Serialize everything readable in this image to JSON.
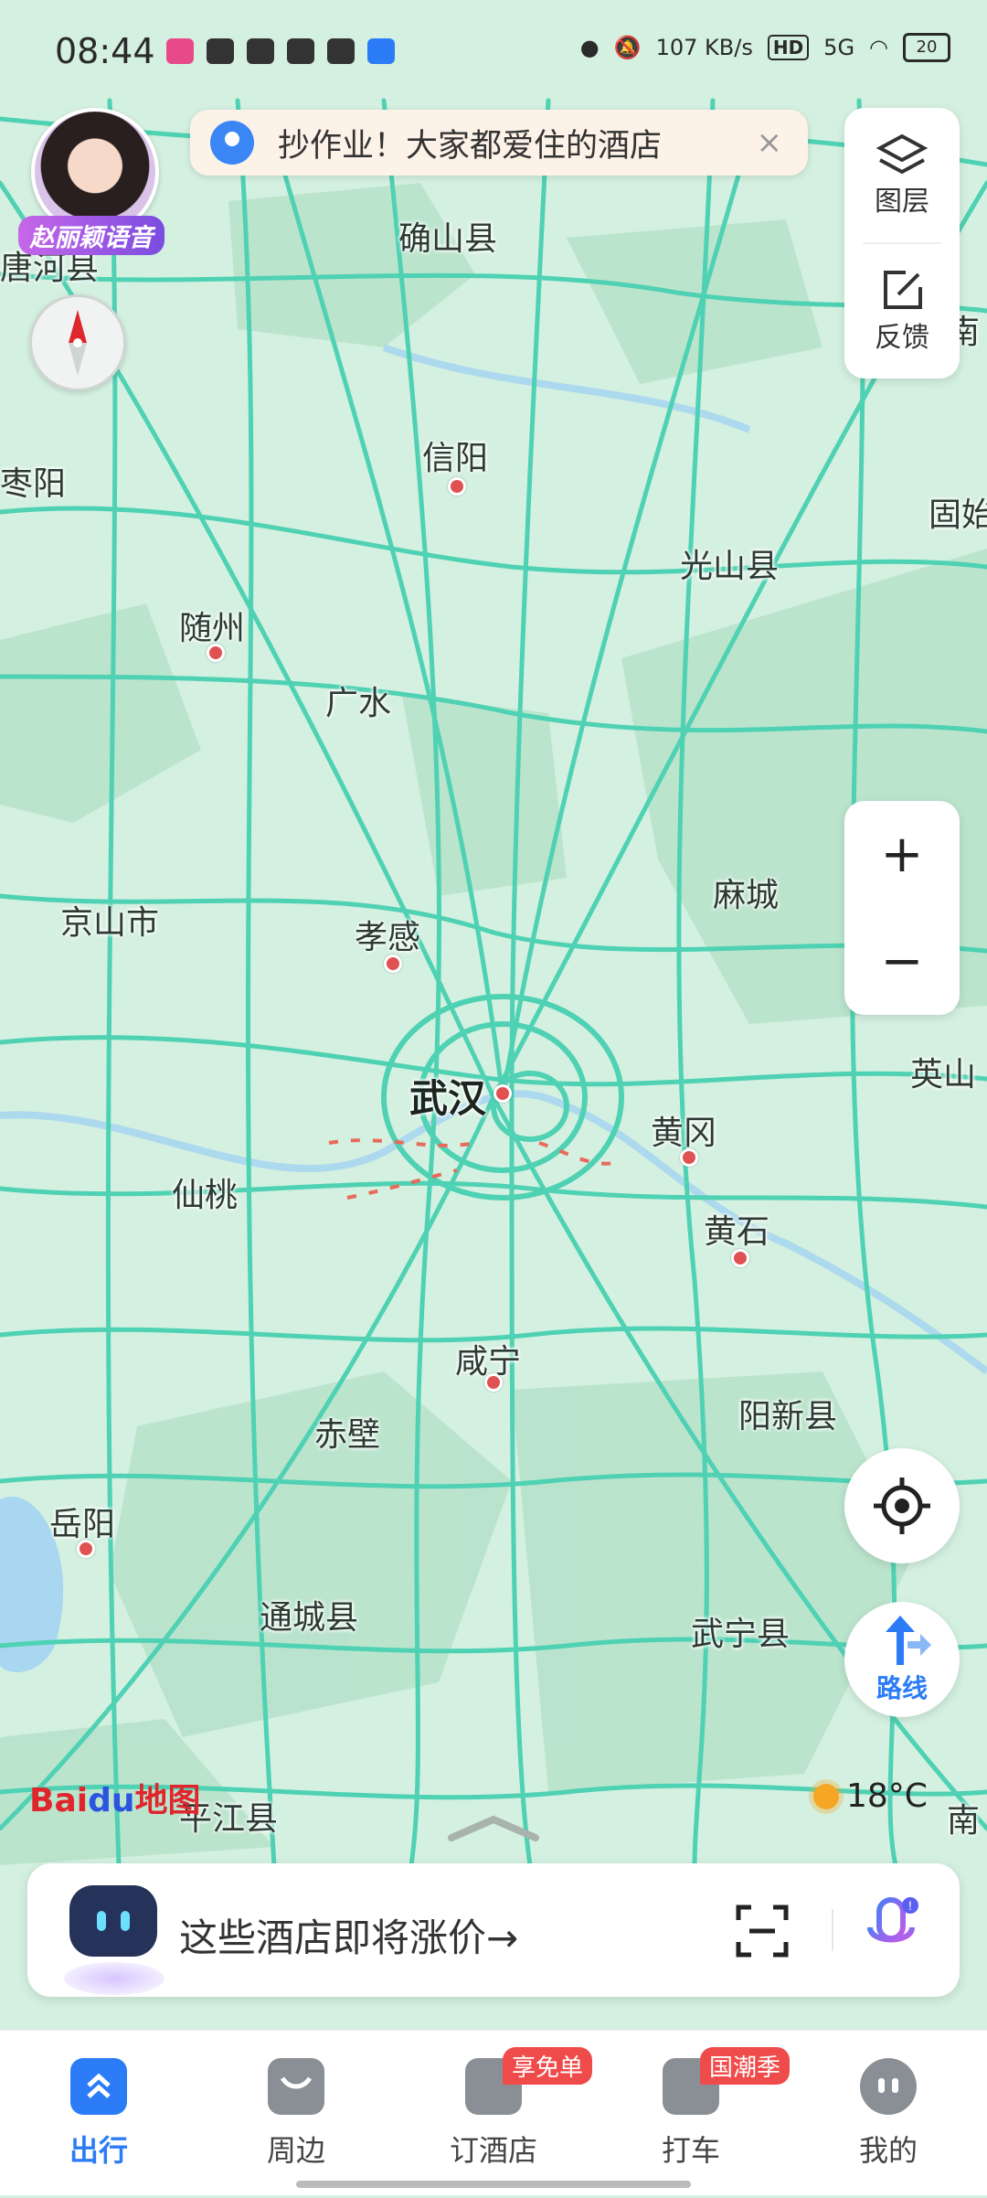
{
  "status_bar": {
    "time": "08:44",
    "net_speed": "107 KB/s",
    "hd": "HD",
    "signal": "5G",
    "battery": "20"
  },
  "voice_pack": {
    "label": "赵丽颖语音"
  },
  "banner": {
    "text": "抄作业！大家都爱住的酒店",
    "close": "×"
  },
  "right_panel": {
    "layers_label": "图层",
    "feedback_label": "反馈",
    "zoom_in": "+",
    "zoom_out": "−",
    "route_label": "路线"
  },
  "map_labels": [
    {
      "name": "确山县"
    },
    {
      "name": "唐河县"
    },
    {
      "name": "枣阳"
    },
    {
      "name": "信阳"
    },
    {
      "name": "固始"
    },
    {
      "name": "光山县"
    },
    {
      "name": "随州"
    },
    {
      "name": "广水"
    },
    {
      "name": "麻城"
    },
    {
      "name": "京山市"
    },
    {
      "name": "孝感"
    },
    {
      "name": "武汉"
    },
    {
      "name": "英山"
    },
    {
      "name": "黄冈"
    },
    {
      "name": "仙桃"
    },
    {
      "name": "黄石"
    },
    {
      "name": "咸宁"
    },
    {
      "name": "阳新县"
    },
    {
      "name": "赤壁"
    },
    {
      "name": "岳阳"
    },
    {
      "name": "通城县"
    },
    {
      "name": "武宁县"
    },
    {
      "name": "平江县"
    },
    {
      "name": "南"
    },
    {
      "name": "南"
    }
  ],
  "logo": {
    "part1": "Bai",
    "part2": "du",
    "part3": "地图"
  },
  "weather": {
    "temp": "18°C"
  },
  "search": {
    "prompt": "这些酒店即将涨价→"
  },
  "nav": {
    "items": [
      {
        "label": "出行",
        "badge": ""
      },
      {
        "label": "周边",
        "badge": ""
      },
      {
        "label": "订酒店",
        "badge": "享免单"
      },
      {
        "label": "打车",
        "badge": "国潮季"
      },
      {
        "label": "我的",
        "badge": ""
      }
    ]
  },
  "colors": {
    "road": "#4fd1b3",
    "accent": "#2b7cf6",
    "badge": "#f04b4b",
    "map_bg": "#d4f0e0",
    "forest": "#b8e2cb"
  }
}
